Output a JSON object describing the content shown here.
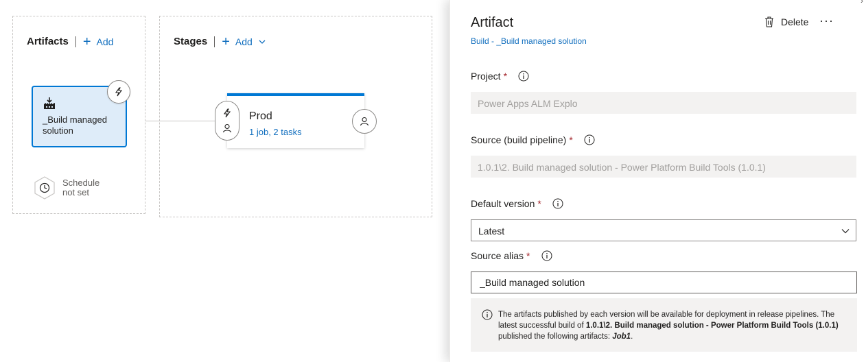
{
  "artifacts_section": {
    "title": "Artifacts",
    "add_label": "Add",
    "artifact": {
      "name": "_Build managed solution"
    },
    "schedule": {
      "line1": "Schedule",
      "line2": "not set"
    }
  },
  "stages_section": {
    "title": "Stages",
    "add_label": "Add",
    "stage": {
      "name": "Prod",
      "summary": "1 job, 2 tasks"
    }
  },
  "panel": {
    "title": "Artifact",
    "subtitle": "Build - _Build managed solution",
    "delete_label": "Delete",
    "more_label": "···",
    "project": {
      "label": "Project",
      "required": "*",
      "value": "Power Apps ALM Explo"
    },
    "source": {
      "label": "Source (build pipeline)",
      "required": "*",
      "value": "1.0.1\\2. Build managed solution - Power Platform Build Tools (1.0.1)"
    },
    "default_version": {
      "label": "Default version",
      "required": "*",
      "value": "Latest"
    },
    "source_alias": {
      "label": "Source alias",
      "required": "*",
      "value": "_Build managed solution"
    },
    "info": {
      "text1": "The artifacts published by each version will be available for deployment in release pipelines. The latest successful build of ",
      "bold": "1.0.1\\2. Build managed solution - Power Platform Build Tools (1.0.1)",
      "text2": " published the following artifacts: ",
      "artifact_name": "Job1",
      "end": "."
    }
  },
  "colors": {
    "accent": "#0078d4",
    "link": "#106ebe",
    "required": "#a4262c",
    "card_bg": "#deecf9"
  }
}
